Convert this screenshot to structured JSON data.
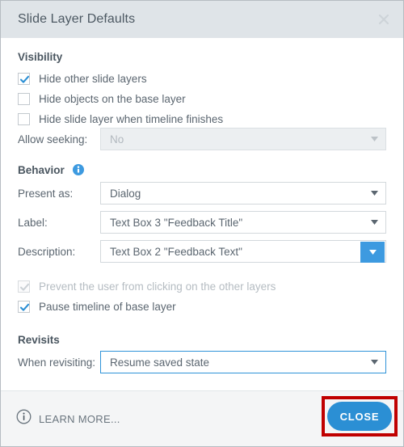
{
  "dialog": {
    "title": "Slide Layer Defaults",
    "close_icon": "close-icon"
  },
  "visibility": {
    "heading": "Visibility",
    "checkboxes": [
      {
        "label": "Hide other slide layers",
        "checked": true,
        "disabled": false
      },
      {
        "label": "Hide objects on the base layer",
        "checked": false,
        "disabled": false
      },
      {
        "label": "Hide slide layer when timeline finishes",
        "checked": false,
        "disabled": false
      }
    ],
    "allow_seeking": {
      "label": "Allow seeking:",
      "value": "No",
      "disabled": true
    }
  },
  "behavior": {
    "heading": "Behavior",
    "info_icon": "info-icon",
    "fields": [
      {
        "label": "Present as:",
        "value": "Dialog"
      },
      {
        "label": "Label:",
        "value": "Text Box 3 \"Feedback Title\""
      },
      {
        "label": "Description:",
        "value": "Text Box 2 \"Feedback Text\""
      }
    ],
    "checkboxes": [
      {
        "label": "Prevent the user from clicking on the other layers",
        "checked": true,
        "disabled": true
      },
      {
        "label": "Pause timeline of base layer",
        "checked": true,
        "disabled": false
      }
    ]
  },
  "revisits": {
    "heading": "Revisits",
    "when_revisiting": {
      "label": "When revisiting:",
      "value": "Resume saved state"
    }
  },
  "footer": {
    "learn_more": "LEARN MORE...",
    "learn_more_icon": "info-circle-icon",
    "close_button": "CLOSE"
  },
  "colors": {
    "accent": "#2b8fd4",
    "titlebar": "#dfe4e8",
    "heading_text": "#4a5660",
    "label_text": "#5b6670",
    "highlight": "#c00000"
  }
}
